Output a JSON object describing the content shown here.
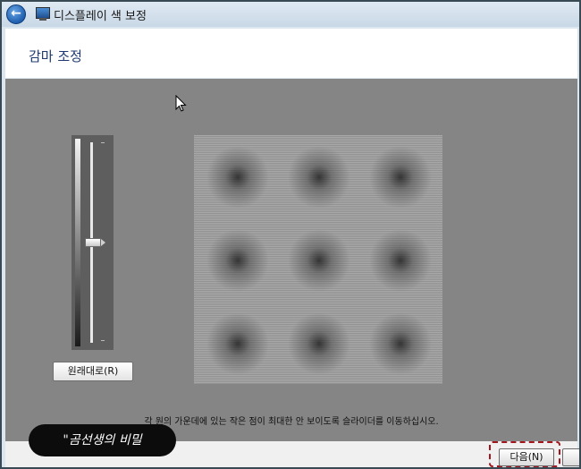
{
  "window": {
    "title": "디스플레이 색 보정"
  },
  "header": {
    "page_title": "감마 조정"
  },
  "slider": {
    "reset_label": "원래대로(R)",
    "gamma_level": 0.5
  },
  "content": {
    "instruction": "각 원의 가운데에 있는 작은 점이 최대한 안 보이도록 슬라이더를 이동하십시오."
  },
  "footer": {
    "next_label": "다음(N)"
  },
  "watermark": {
    "text": "\"곰선생의 비밀"
  },
  "icons": {
    "back": "back-arrow-icon",
    "app": "display-icon",
    "cursor": "mouse-pointer-icon"
  },
  "colors": {
    "content_bg": "#858585",
    "highlight": "#a3161d",
    "title_text": "#1e3a6e"
  }
}
